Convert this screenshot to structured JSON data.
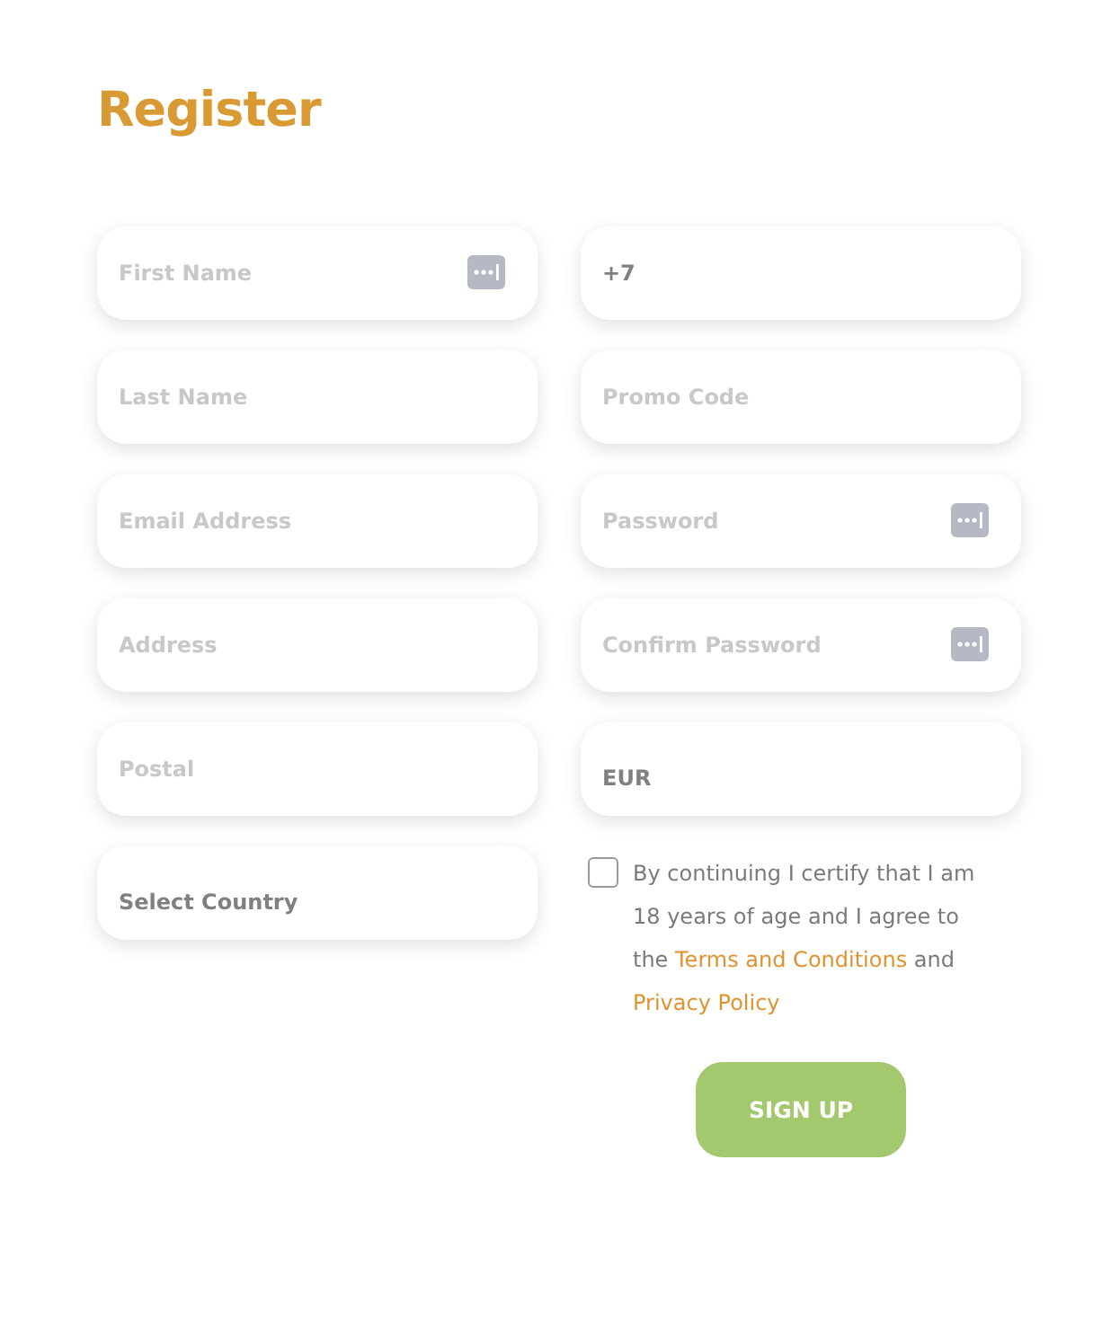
{
  "title": "Register",
  "columns": [
    [
      {
        "kind": "text",
        "placeholder": "First Name",
        "icon": true
      },
      {
        "kind": "text",
        "placeholder": "Last Name",
        "icon": false
      },
      {
        "kind": "text",
        "placeholder": "Email Address",
        "icon": false
      },
      {
        "kind": "text",
        "placeholder": "Address",
        "icon": false
      },
      {
        "kind": "text",
        "placeholder": "Postal",
        "icon": false
      },
      {
        "kind": "select",
        "value": "Select Country",
        "icon": false
      }
    ],
    [
      {
        "kind": "text",
        "value": "+7",
        "icon": false
      },
      {
        "kind": "text",
        "placeholder": "Promo Code",
        "icon": false
      },
      {
        "kind": "text",
        "placeholder": "Password",
        "icon": true
      },
      {
        "kind": "text",
        "placeholder": "Confirm Password",
        "icon": true
      },
      {
        "kind": "select",
        "value": "EUR",
        "icon": false
      }
    ]
  ],
  "consent": {
    "checked": false,
    "text": "By continuing I certify that I am 18 years of age and I agree to the",
    "terms_link": "Terms and Conditions",
    "joiner": "and",
    "privacy_link": "Privacy Policy"
  },
  "button": "SIGN UP"
}
